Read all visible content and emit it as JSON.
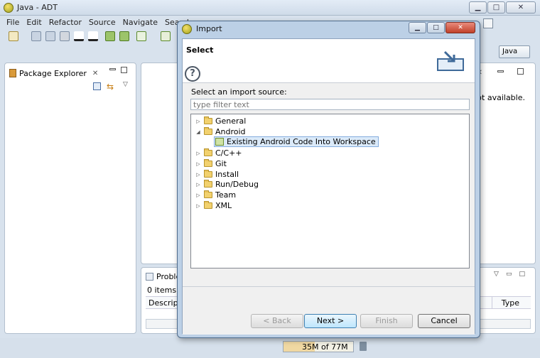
{
  "ide": {
    "title": "Java - ADT",
    "menu": [
      "File",
      "Edit",
      "Refactor",
      "Source",
      "Navigate",
      "Search"
    ],
    "perspective_label": "Java",
    "package_explorer_tab": "Package Explorer",
    "editor_message": "not available.",
    "problems": {
      "tab_label": "Proble",
      "count": "0 items",
      "col_description": "Descripti",
      "col_type": "Type"
    },
    "status": {
      "memory_used": "35M",
      "memory_total": "of 77M",
      "memory_fraction": 0.45
    }
  },
  "dialog": {
    "title": "Import",
    "heading": "Select",
    "source_label": "Select an import source:",
    "filter_placeholder": "type filter text",
    "tree": [
      {
        "label": "General",
        "expanded": false
      },
      {
        "label": "Android",
        "expanded": true
      },
      {
        "label": "Existing Android Code Into Workspace",
        "child": true,
        "selected": true
      },
      {
        "label": "C/C++",
        "expanded": false
      },
      {
        "label": "Git",
        "expanded": false
      },
      {
        "label": "Install",
        "expanded": false
      },
      {
        "label": "Run/Debug",
        "expanded": false
      },
      {
        "label": "Team",
        "expanded": false
      },
      {
        "label": "XML",
        "expanded": false
      }
    ],
    "buttons": {
      "help": "?",
      "back": "< Back",
      "next": "Next >",
      "finish": "Finish",
      "cancel": "Cancel"
    }
  },
  "icons": {
    "close": "close-icon",
    "minimize": "minimize-icon",
    "maximize": "maximize-icon"
  }
}
